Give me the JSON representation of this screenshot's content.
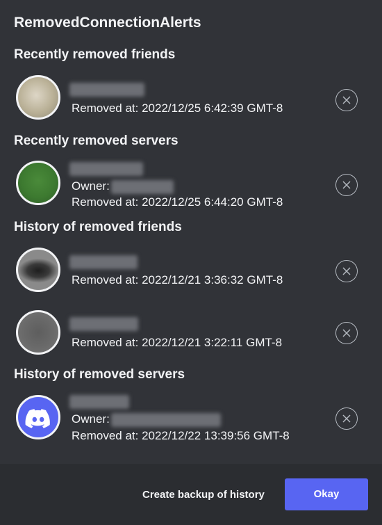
{
  "modal": {
    "title": "RemovedConnectionAlerts",
    "sections": {
      "recent_friends": {
        "title": "Recently removed friends",
        "items": [
          {
            "removed_at": "Removed at: 2022/12/25 6:42:39 GMT-8"
          }
        ]
      },
      "recent_servers": {
        "title": "Recently removed servers",
        "items": [
          {
            "owner_label": "Owner:",
            "removed_at": "Removed at: 2022/12/25 6:44:20 GMT-8"
          }
        ]
      },
      "history_friends": {
        "title": "History of removed friends",
        "items": [
          {
            "removed_at": "Removed at: 2022/12/21 3:36:32 GMT-8"
          },
          {
            "removed_at": "Removed at: 2022/12/21 3:22:11 GMT-8"
          }
        ]
      },
      "history_servers": {
        "title": "History of removed servers",
        "items": [
          {
            "owner_label": "Owner:",
            "removed_at": "Removed at: 2022/12/22 13:39:56 GMT-8"
          }
        ]
      }
    },
    "footer": {
      "backup_label": "Create backup of history",
      "okay_label": "Okay"
    },
    "colors": {
      "background": "#313338",
      "footer": "#2b2d31",
      "brand": "#5865f2"
    }
  }
}
